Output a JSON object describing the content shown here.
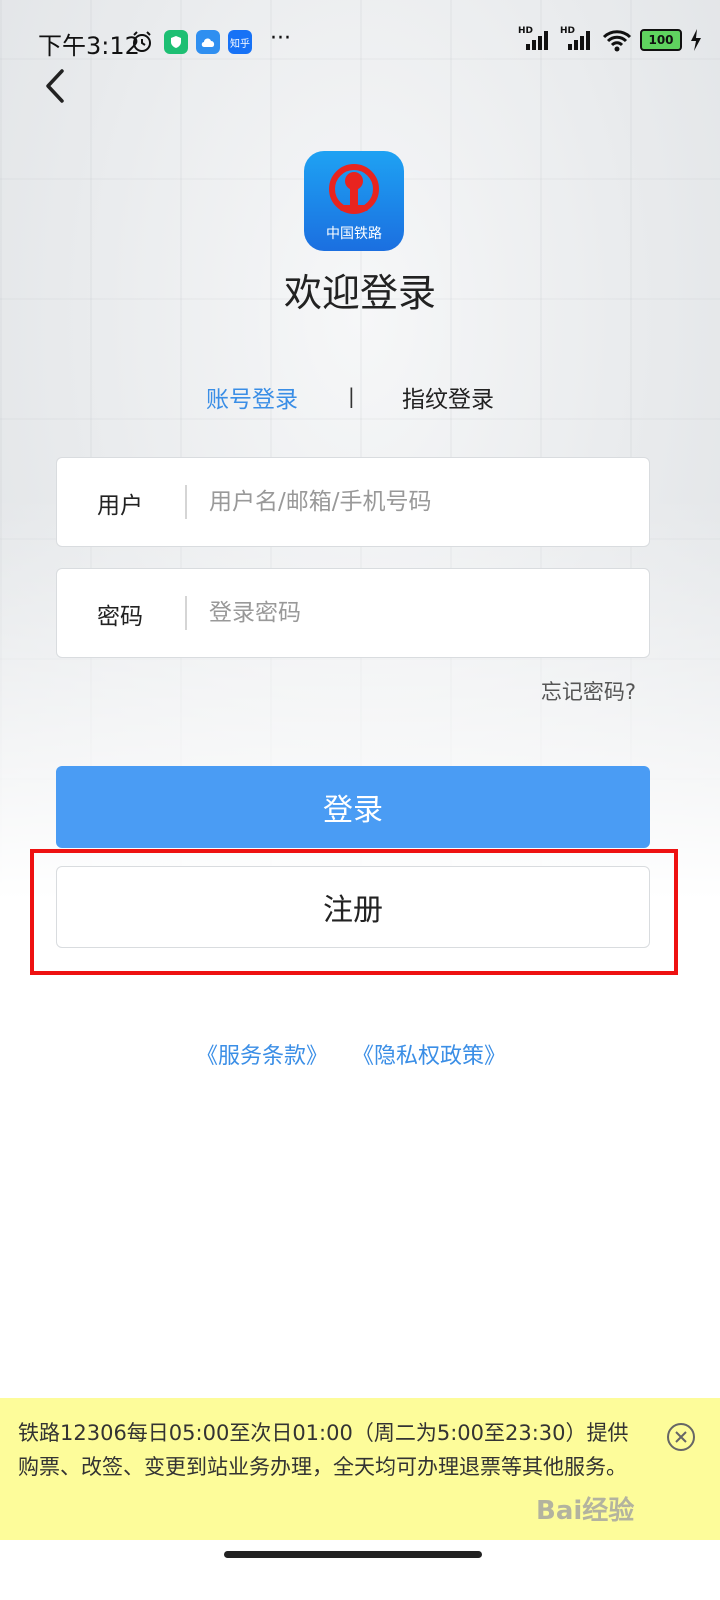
{
  "status_bar": {
    "time": "下午3:12",
    "app_icon_zhihu": "知乎",
    "more": "···",
    "network_1": "HD",
    "network_2": "HD",
    "battery": "100",
    "icons": [
      "alarm-icon",
      "shield-app-icon",
      "cloud-app-icon",
      "zhihu-app-icon",
      "signal-icon",
      "wifi-icon",
      "battery-icon",
      "charging-icon"
    ]
  },
  "header": {
    "back_icon": "chevron-left-icon"
  },
  "logo": {
    "label": "中国铁路"
  },
  "title": "欢迎登录",
  "tabs": {
    "account": "账号登录",
    "divider": "|",
    "fingerprint": "指纹登录"
  },
  "form": {
    "user_label": "用户",
    "user_placeholder": "用户名/邮箱/手机号码",
    "password_label": "密码",
    "password_placeholder": "登录密码",
    "forgot": "忘记密码?"
  },
  "buttons": {
    "login": "登录",
    "register": "注册"
  },
  "links": {
    "terms": "《服务条款》",
    "privacy": "《隐私权政策》"
  },
  "notice": {
    "text": "铁路12306每日05:00至次日01:00（周二为5:00至23:30）提供购票、改签、变更到站业务办理，全天均可办理退票等其他服务。"
  },
  "watermark": "Bai经验",
  "colors": {
    "accent": "#3a8ee6",
    "login_button": "#4a9cf4",
    "highlight": "#ee1111",
    "notice_bg": "#fdfc9a",
    "logo_bg": "#1b8cf0"
  }
}
